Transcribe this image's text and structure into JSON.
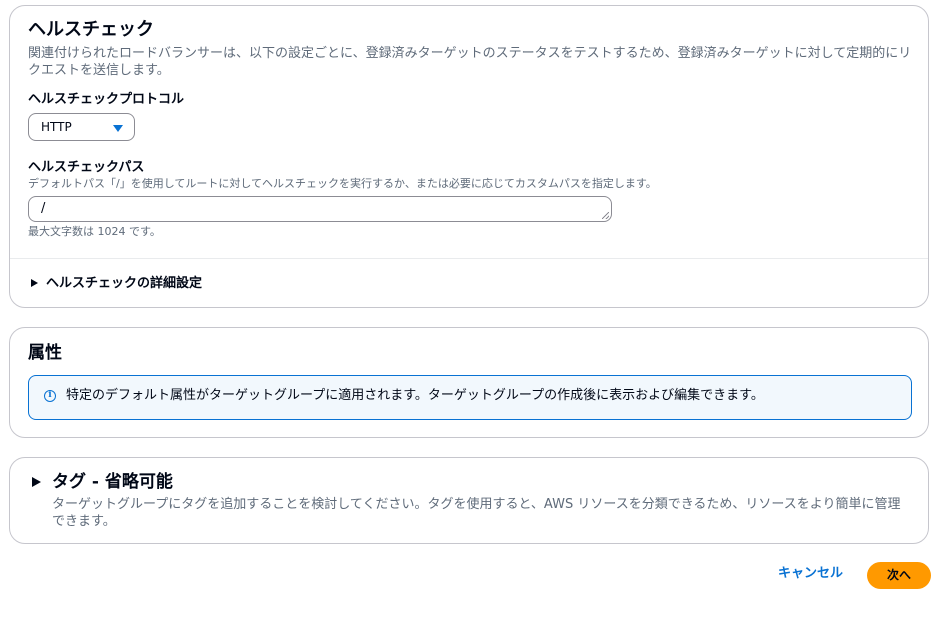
{
  "health_check": {
    "title": "ヘルスチェック",
    "description": "関連付けられたロードバランサーは、以下の設定ごとに、登録済みターゲットのステータスをテストするため、登録済みターゲットに対して定期的にリクエストを送信します。",
    "protocol_label": "ヘルスチェックプロトコル",
    "protocol_value": "HTTP",
    "path_label": "ヘルスチェックパス",
    "path_hint": "デフォルトパス「/」を使用してルートに対してヘルスチェックを実行するか、または必要に応じてカスタムパスを指定します。",
    "path_value": "/",
    "path_constraint": "最大文字数は 1024 です。",
    "advanced_label": "ヘルスチェックの詳細設定"
  },
  "attributes": {
    "title": "属性",
    "info_text": "特定のデフォルト属性がターゲットグループに適用されます。ターゲットグループの作成後に表示および編集できます。",
    "info_icon": "info-icon"
  },
  "tags": {
    "title": "タグ - 省略可能",
    "description": "ターゲットグループにタグを追加することを検討してください。タグを使用すると、AWS リソースを分類できるため、リソースをより簡単に管理できます。"
  },
  "footer": {
    "cancel_label": "キャンセル",
    "next_label": "次へ"
  },
  "colors": {
    "accent": "#0972d3",
    "primary_button": "#ff9900",
    "border": "#c6c6cd",
    "info_bg": "#f2f8fd"
  }
}
